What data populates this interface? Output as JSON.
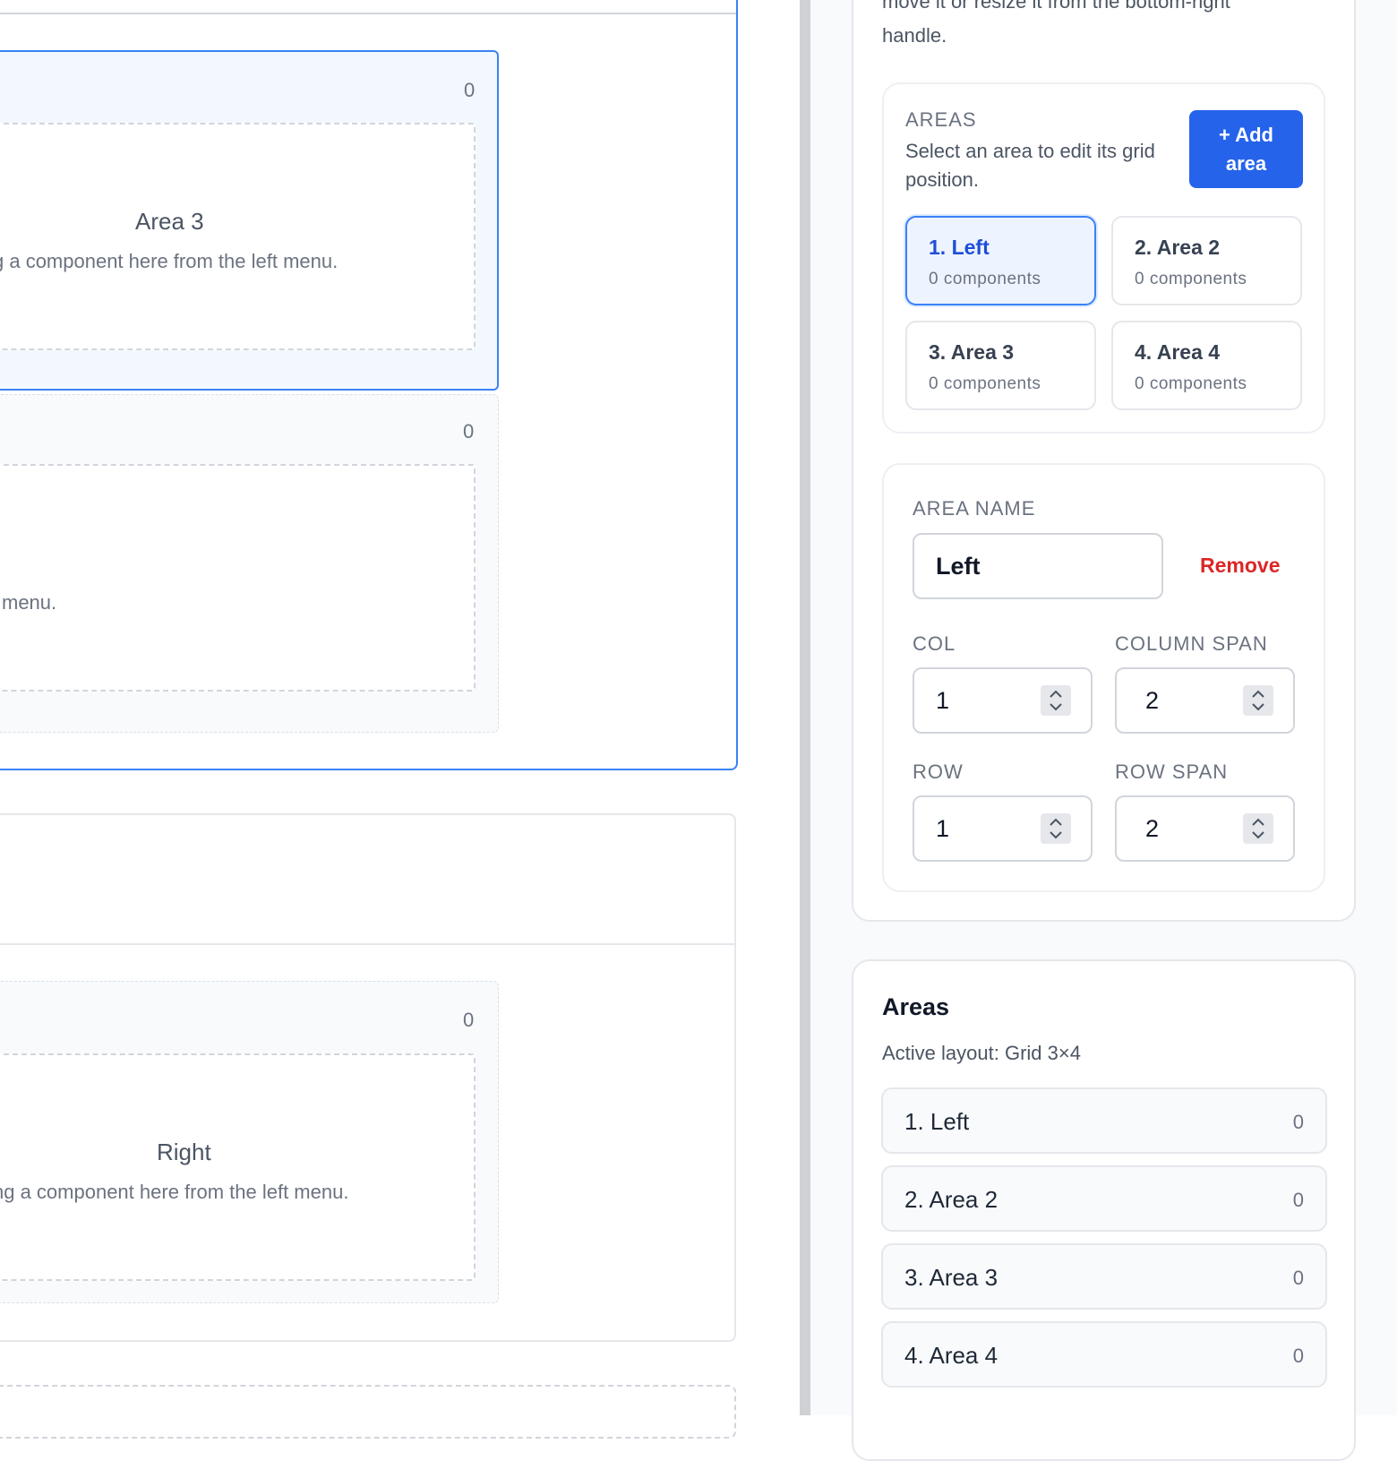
{
  "canvas": {
    "areas": [
      {
        "title": "Area 3",
        "count": "0",
        "hint": "g a component here from the left menu."
      },
      {
        "title": "",
        "count": "0",
        "hint": "menu."
      },
      {
        "title": "Right",
        "count": "0",
        "hint": "ng a component here from the left menu."
      }
    ]
  },
  "panel": {
    "help_top": "move it or resize it from the bottom-right",
    "help_bottom": "handle.",
    "areas_section": {
      "heading": "AREAS",
      "description": "Select an area to edit its grid position.",
      "add_button": "+ Add area",
      "tiles": [
        {
          "title": "1. Left",
          "sub": "0 components",
          "active": true
        },
        {
          "title": "2. Area 2",
          "sub": "0 components",
          "active": false
        },
        {
          "title": "3. Area 3",
          "sub": "0 components",
          "active": false
        },
        {
          "title": "4. Area 4",
          "sub": "0 components",
          "active": false
        }
      ]
    },
    "editor": {
      "name_label": "AREA NAME",
      "name_value": "Left",
      "remove_label": "Remove",
      "col_label": "COL",
      "col_value": "1",
      "colspan_label": "COLUMN SPAN",
      "colspan_value": "2",
      "row_label": "ROW",
      "row_value": "1",
      "rowspan_label": "ROW SPAN",
      "rowspan_value": "2"
    }
  },
  "areas_list": {
    "title": "Areas",
    "subtitle": "Active layout: Grid 3×4",
    "items": [
      {
        "name": "1. Left",
        "count": "0"
      },
      {
        "name": "2. Area 2",
        "count": "0"
      },
      {
        "name": "3. Area 3",
        "count": "0"
      },
      {
        "name": "4. Area 4",
        "count": "0"
      }
    ]
  },
  "colors": {
    "accent": "#2563eb",
    "danger": "#dc2626",
    "selected_border": "#3b82f6"
  }
}
